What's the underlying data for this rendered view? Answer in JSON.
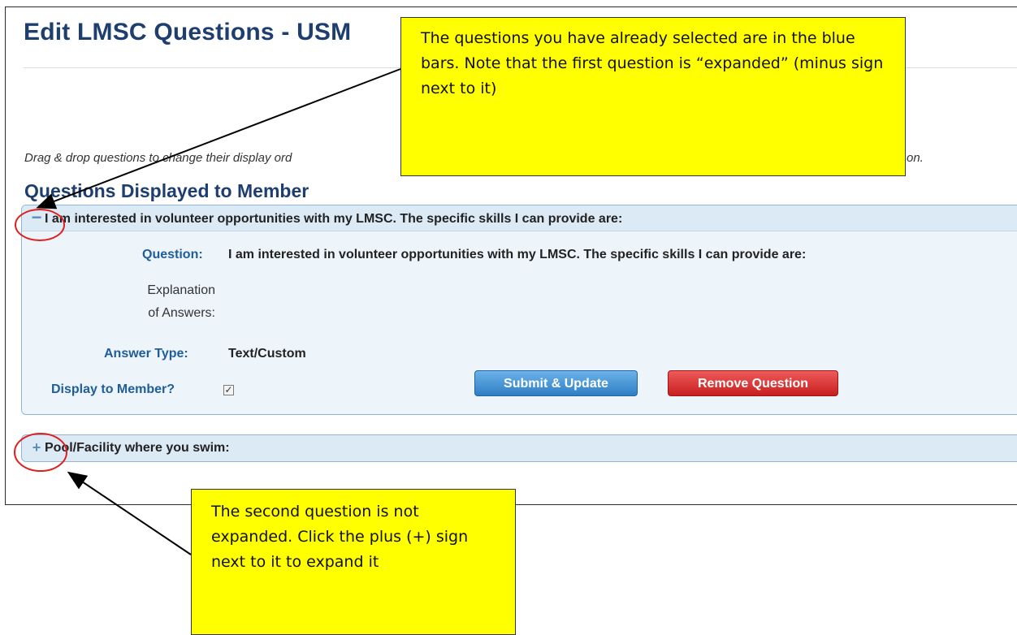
{
  "page": {
    "title": "Edit LMSC Questions - USM",
    "instructions_visible": "Drag & drop questions to change their display ord",
    "instructions_tail": "on.",
    "section_heading": "Questions Displayed to Member"
  },
  "questions": [
    {
      "toggle": "−",
      "header": "I am interested in volunteer opportunities with my LMSC. The specific skills I can provide are:",
      "expanded": true,
      "fields": {
        "question_label": "Question:",
        "question_value": "I am interested in volunteer opportunities with my LMSC. The specific skills I can provide are:",
        "explanation_label_line1": "Explanation",
        "explanation_label_line2": "of Answers:",
        "answer_type_label": "Answer Type:",
        "answer_type_value": "Text/Custom",
        "display_label": "Display to Member?",
        "display_checked": true,
        "checkbox_mark": "✓"
      },
      "buttons": {
        "submit": "Submit & Update",
        "remove": "Remove Question"
      }
    },
    {
      "toggle": "+",
      "header": "Pool/Facility where you swim:",
      "expanded": false
    }
  ],
  "callouts": {
    "top": "The questions you have already selected are in the blue bars. Note that the first question is “expanded” (minus sign next to it)",
    "bottom": "The second question is not expanded. Click the plus (+) sign next to it to expand it"
  },
  "colors": {
    "title": "#1d3e6e",
    "label_blue": "#1e5d9a",
    "panel_bg": "#edf4fa",
    "header_bg": "#dceaf6",
    "submit_button": "#3a8bd0",
    "remove_button": "#d42a2a",
    "callout_bg": "#ffff00",
    "circle": "#e02020"
  }
}
